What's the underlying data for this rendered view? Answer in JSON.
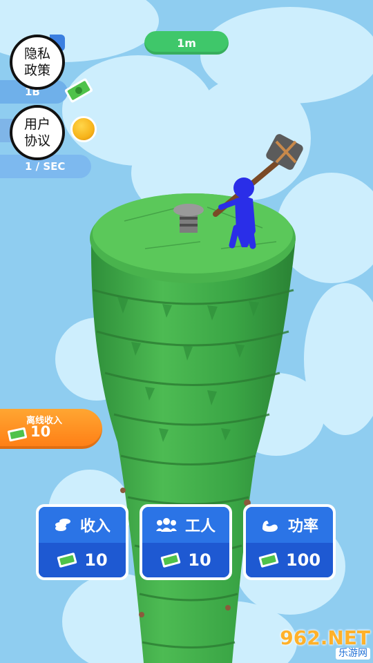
{
  "hud": {
    "distance": "1m",
    "money_value": "1B",
    "rate_value": "1 / SEC"
  },
  "buttons": {
    "privacy": "隐私\n政策",
    "terms": "用户\n协议"
  },
  "offline": {
    "title": "离线收入",
    "value": "10"
  },
  "upgrades": [
    {
      "label": "收入",
      "cost": "10",
      "icon": "coins-icon"
    },
    {
      "label": "工人",
      "cost": "10",
      "icon": "workers-icon"
    },
    {
      "label": "功率",
      "cost": "100",
      "icon": "muscle-icon"
    }
  ],
  "watermark": {
    "top": "962.NET",
    "bottom": "乐游网"
  },
  "colors": {
    "sky": "#8fcdf0",
    "tower_green": "#3fa64a",
    "card_blue": "#2b74e6",
    "offline_orange": "#ff8a1e",
    "pill_green": "#3fc76a",
    "player_blue": "#2a2ee8"
  }
}
